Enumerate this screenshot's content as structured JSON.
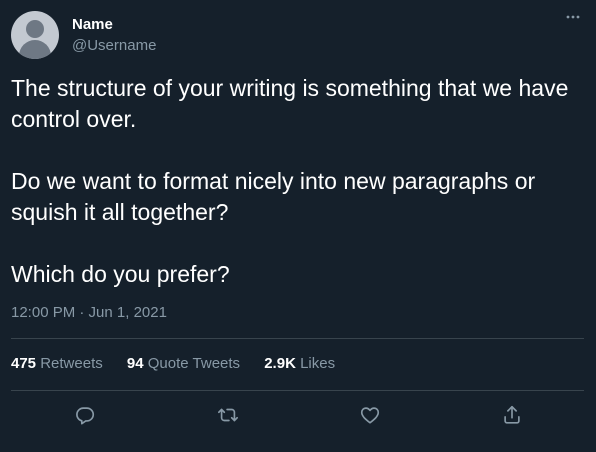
{
  "author": {
    "display_name": "Name",
    "username": "@Username"
  },
  "tweet": {
    "paragraphs": [
      "The structure of your writing is something that we have control over.",
      "Do we want to format nicely into new paragraphs or squish it all together?",
      "Which do you prefer?"
    ],
    "timestamp": "12:00 PM · Jun 1, 2021"
  },
  "stats": {
    "retweets_count": "475",
    "retweets_label": "Retweets",
    "quote_tweets_count": "94",
    "quote_tweets_label": "Quote Tweets",
    "likes_count": "2.9K",
    "likes_label": "Likes"
  },
  "icons": {
    "more": "more-horizontal-icon",
    "reply": "reply-icon",
    "retweet": "retweet-icon",
    "like": "heart-icon",
    "share": "share-icon"
  },
  "colors": {
    "background": "#15202b",
    "primary_text": "#ffffff",
    "secondary_text": "#8899a6",
    "divider": "#38444d"
  }
}
